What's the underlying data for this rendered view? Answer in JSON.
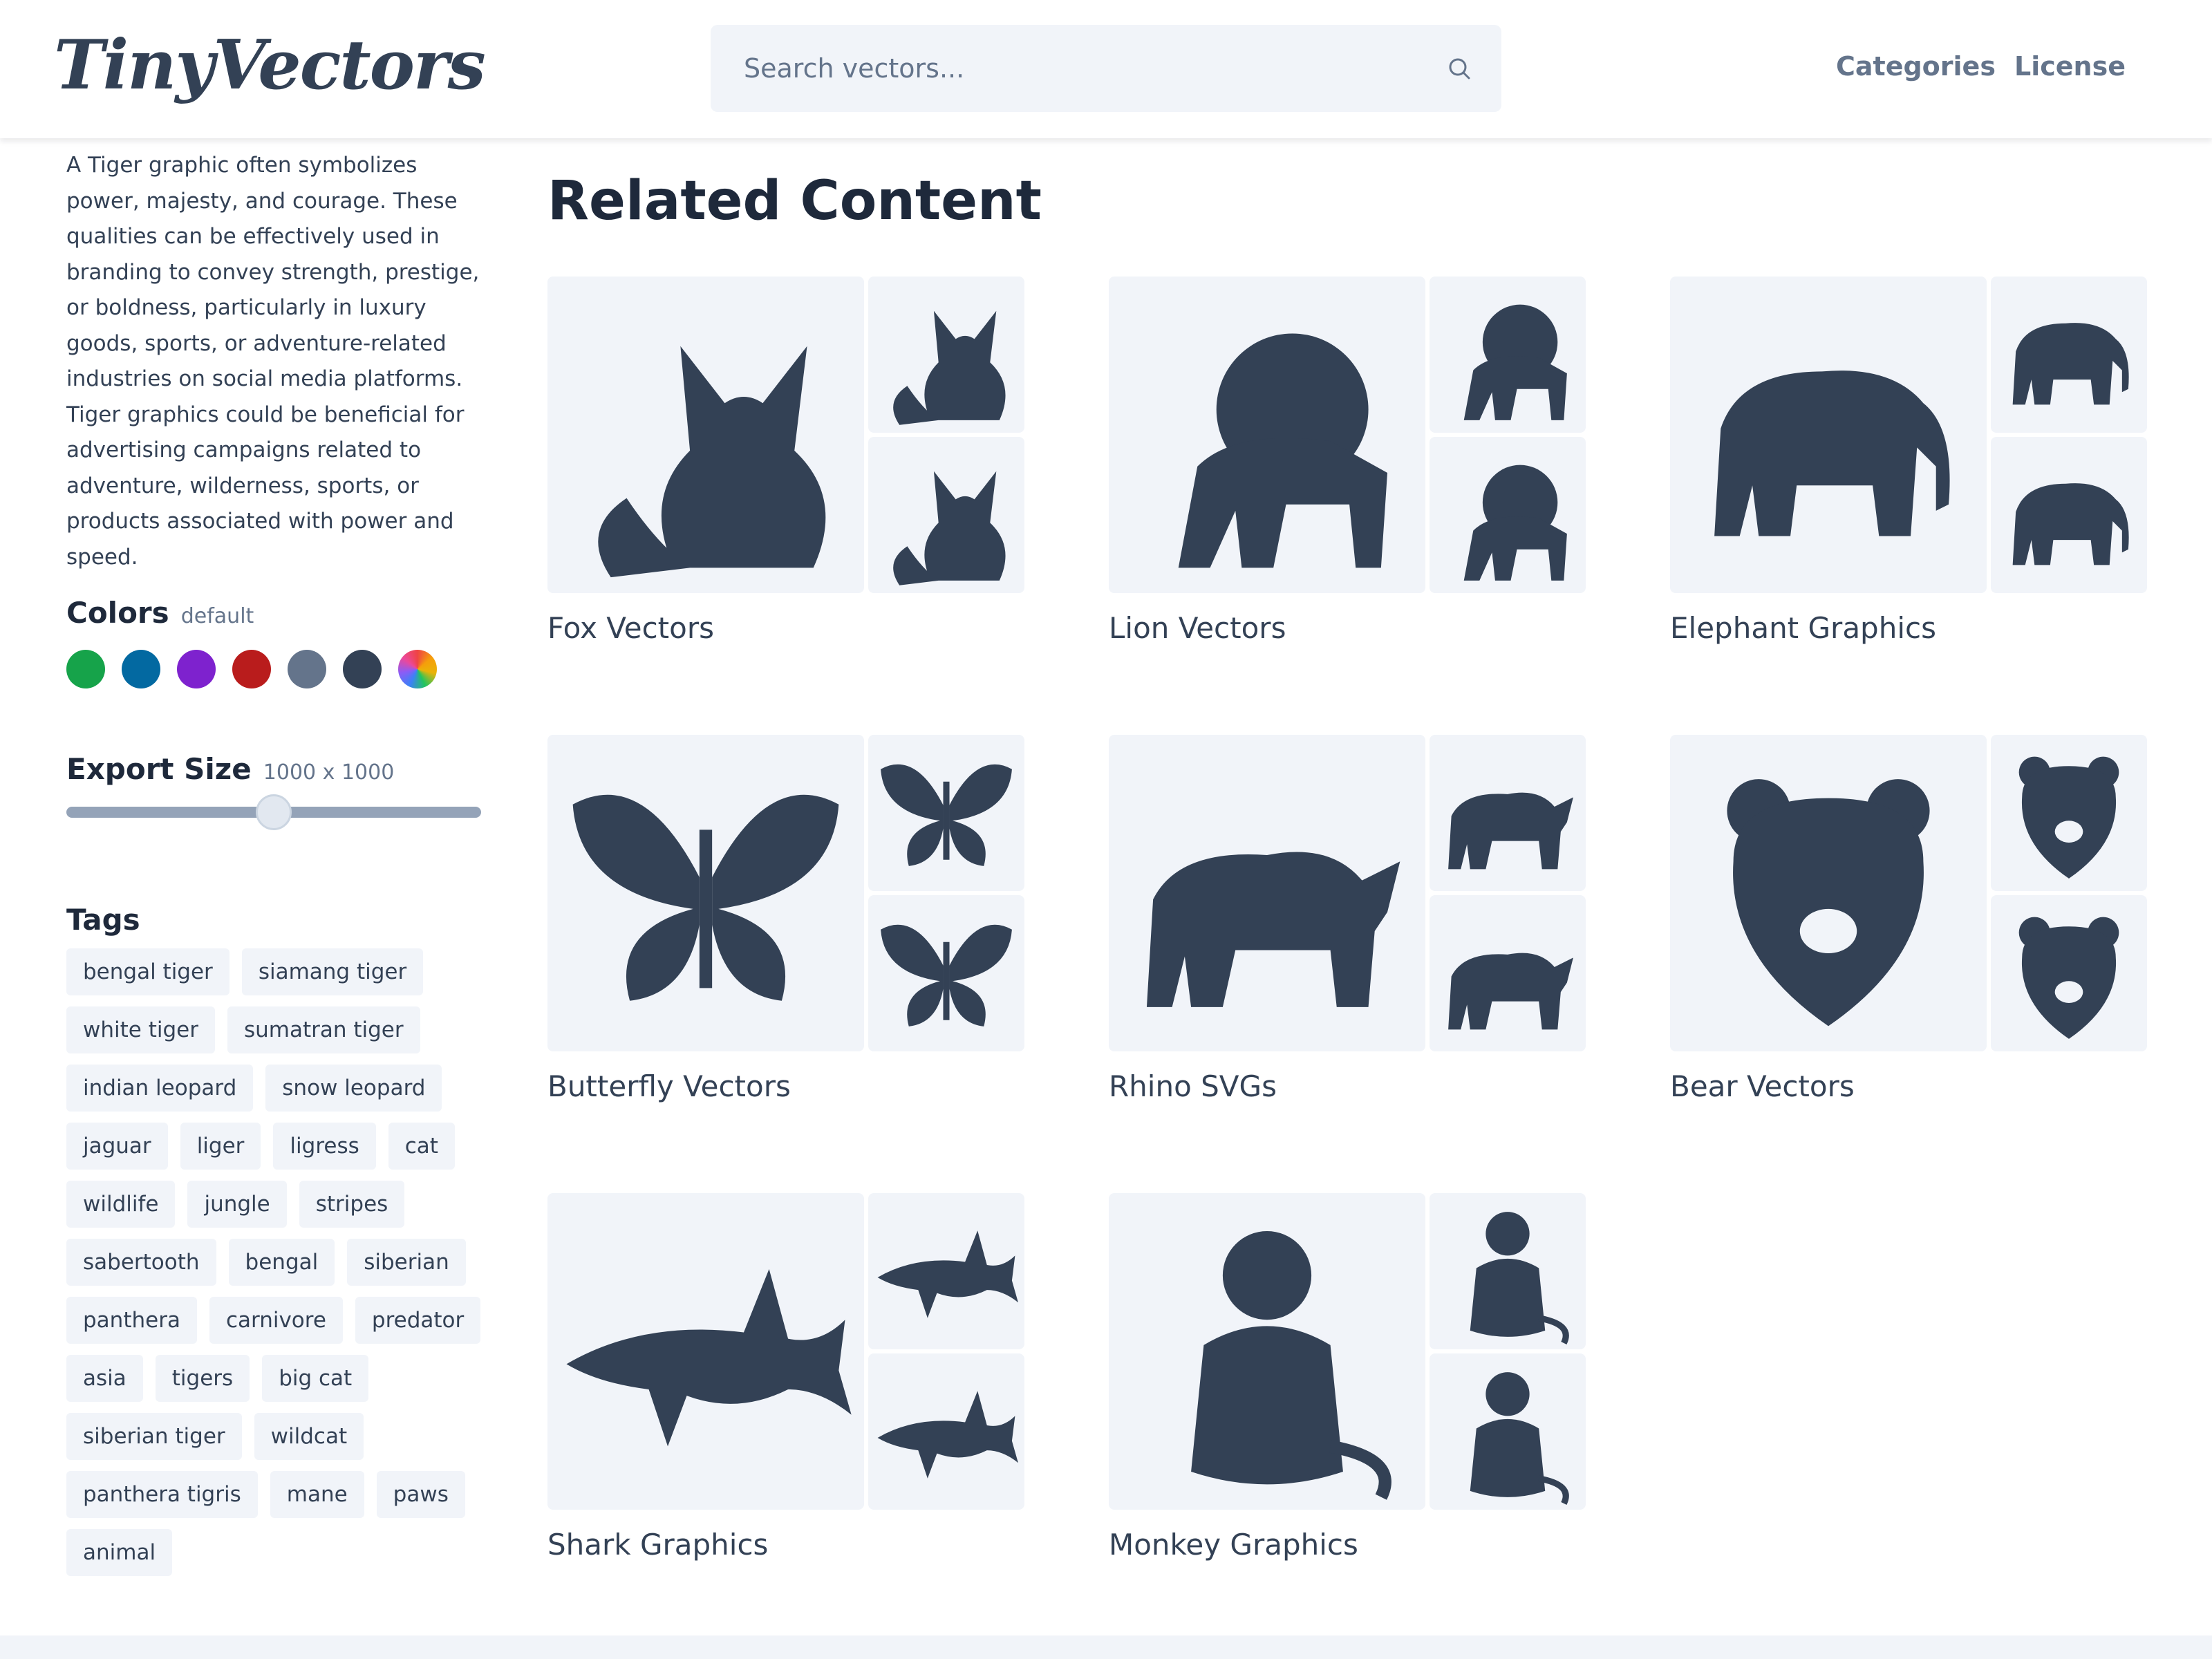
{
  "header": {
    "logo": "TinyVectors",
    "search_placeholder": "Search vectors...",
    "nav": [
      "Categories",
      "License"
    ]
  },
  "sidebar": {
    "description": "A Tiger graphic often symbolizes power, majesty, and courage. These qualities can be effectively used in branding to convey strength, prestige, or boldness, particularly in luxury goods, sports, or adventure-related industries on social media platforms. Tiger graphics could be beneficial for advertising campaigns related to adventure, wilderness, sports, or products associated with power and speed.",
    "colors_title": "Colors",
    "colors_sub": "default",
    "colors": [
      "#16a34a",
      "#0369a1",
      "#7e22ce",
      "#b91c1c",
      "#64748b",
      "#334155",
      "rainbow"
    ],
    "export_title": "Export Size",
    "export_value": "1000 x 1000",
    "export_slider_fraction": 0.5,
    "tags_title": "Tags",
    "tags": [
      "bengal tiger",
      "siamang tiger",
      "white tiger",
      "sumatran tiger",
      "indian leopard",
      "snow leopard",
      "jaguar",
      "liger",
      "ligress",
      "cat",
      "wildlife",
      "jungle",
      "stripes",
      "sabertooth",
      "bengal",
      "siberian",
      "panthera",
      "carnivore",
      "predator",
      "asia",
      "tigers",
      "big cat",
      "siberian tiger",
      "wildcat",
      "panthera tigris",
      "mane",
      "paws",
      "animal"
    ]
  },
  "main": {
    "title": "Related Content",
    "cards": [
      {
        "label": "Fox Vectors",
        "icon": "fox-icon"
      },
      {
        "label": "Lion Vectors",
        "icon": "lion-icon"
      },
      {
        "label": "Elephant Graphics",
        "icon": "elephant-icon"
      },
      {
        "label": "Butterfly Vectors",
        "icon": "butterfly-icon"
      },
      {
        "label": "Rhino SVGs",
        "icon": "rhino-icon"
      },
      {
        "label": "Bear Vectors",
        "icon": "bear-icon"
      },
      {
        "label": "Shark Graphics",
        "icon": "shark-icon"
      },
      {
        "label": "Monkey Graphics",
        "icon": "monkey-icon"
      }
    ]
  },
  "colors": {
    "ink": "#334155",
    "tile": "#f1f4f9"
  }
}
